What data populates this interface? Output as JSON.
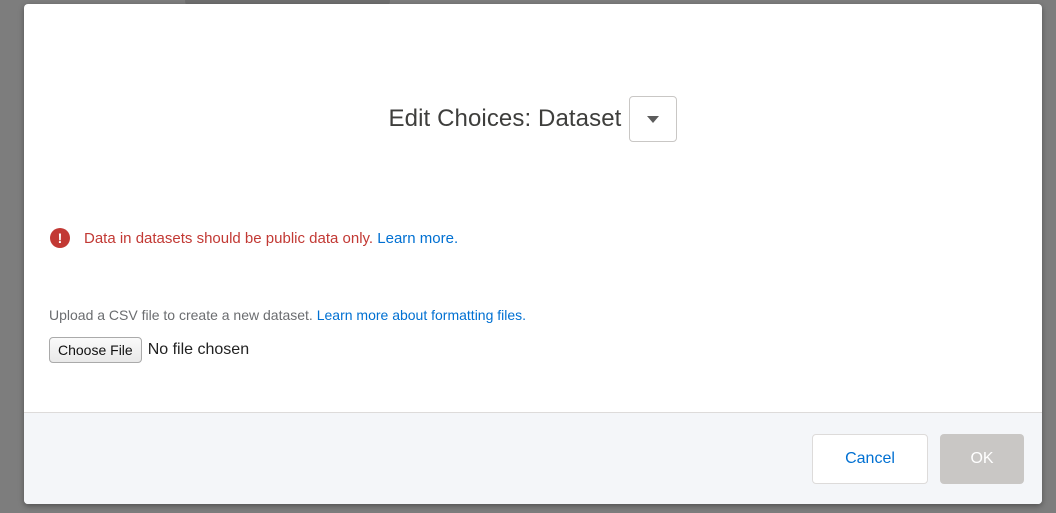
{
  "dialog": {
    "title": "Edit Choices: Dataset",
    "dropdown_icon": "caret-down-icon",
    "warning": {
      "icon": "exclamation-circle-icon",
      "text": "Data in datasets should be public data only.",
      "link": "Learn more."
    },
    "upload": {
      "help_text": "Upload a CSV file to create a new dataset.",
      "help_link": "Learn more about formatting files.",
      "choose_label": "Choose File",
      "file_status": "No file chosen"
    },
    "footer": {
      "cancel_label": "Cancel",
      "ok_label": "OK"
    }
  },
  "colors": {
    "error": "#c23934",
    "link": "#0070d2",
    "disabled_button": "#c9c7c5"
  }
}
